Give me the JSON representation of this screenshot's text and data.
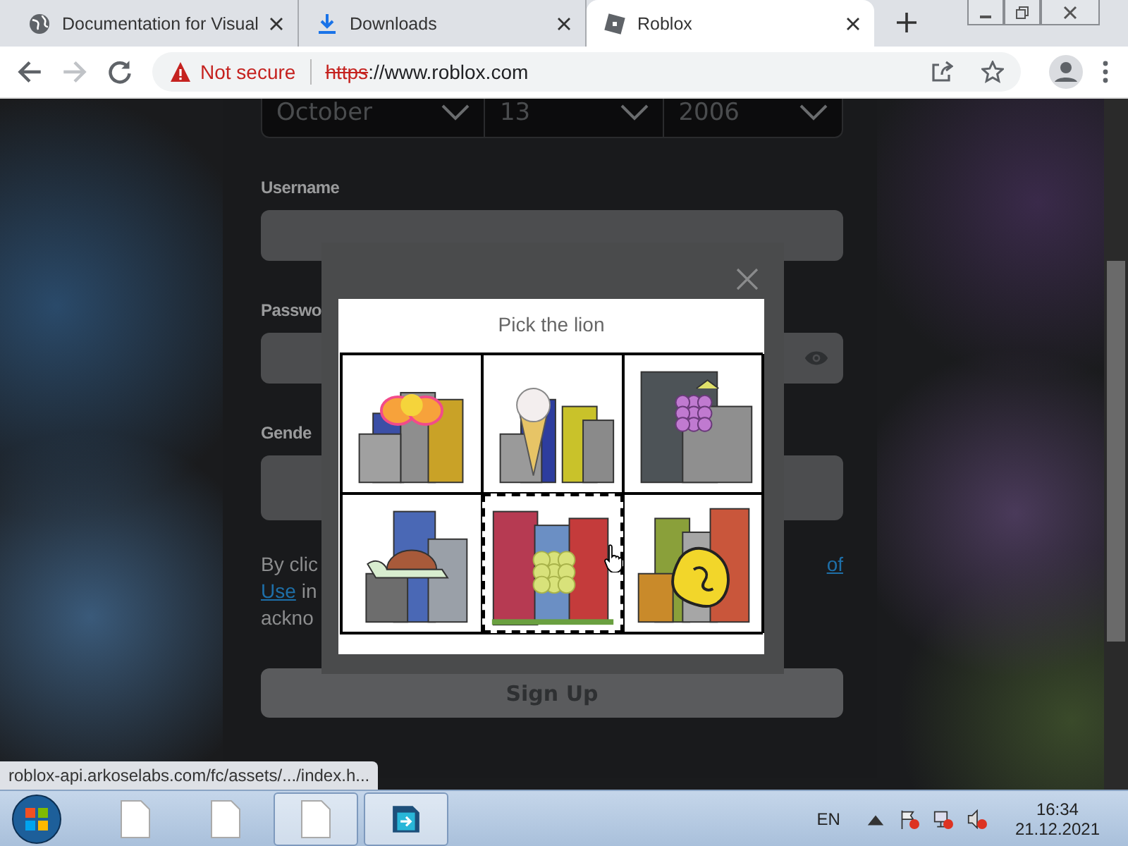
{
  "browser": {
    "tabs": [
      {
        "title": "Documentation for Visual",
        "selected": false
      },
      {
        "title": "Downloads",
        "selected": false
      },
      {
        "title": "Roblox",
        "selected": true
      }
    ],
    "nav_buttons": [
      {
        "kind": "back",
        "disabled": false
      },
      {
        "kind": "forward",
        "disabled": true
      },
      {
        "kind": "reload",
        "disabled": false
      }
    ],
    "address": {
      "security": "Not secure",
      "scheme": "https",
      "rest": "://www.roblox.com"
    }
  },
  "signup": {
    "birthday": [
      {
        "value": "October"
      },
      {
        "value": "13"
      },
      {
        "value": "2006"
      }
    ],
    "username_label": "Username",
    "password_label": "Passwo",
    "gender_label": "Gende",
    "terms": {
      "line1_start": "By clic",
      "line1_link": "of",
      "line2_link": "Use",
      "line2_text": "in",
      "line3": "ackno"
    },
    "submit": "Sign Up"
  },
  "captcha": {
    "prompt": "Pick the lion",
    "cells": [
      {
        "selected": false
      },
      {
        "selected": false
      },
      {
        "selected": false
      },
      {
        "selected": false
      },
      {
        "selected": true
      },
      {
        "selected": false
      }
    ]
  },
  "status_url": "roblox-api.arkoselabs.com/fc/assets/.../index.h...",
  "taskbar": {
    "buttons": [
      {
        "kind": "document",
        "running": false
      },
      {
        "kind": "document",
        "running": false
      },
      {
        "kind": "document",
        "running": true
      },
      {
        "kind": "app",
        "running": true
      }
    ],
    "language": "EN",
    "time": "16:34",
    "date": "21.12.2021"
  }
}
